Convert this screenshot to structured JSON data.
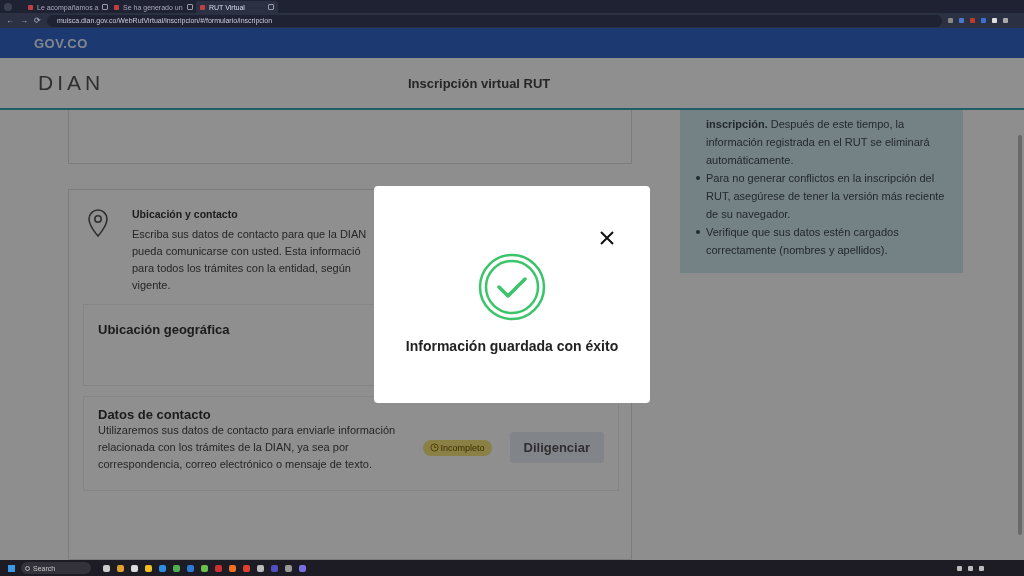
{
  "browser": {
    "nav": [
      "←",
      "→",
      "⟳"
    ],
    "tabs": [
      {
        "title": "Le acompañamos a",
        "selected": false
      },
      {
        "title": "Se ha generado un",
        "selected": false
      },
      {
        "title": "RUT Virtual",
        "selected": true
      }
    ],
    "address": "muisca.dian.gov.co/WebRutVirtual/inscripcion/#/formulario/inscripcion"
  },
  "gov_bar": {
    "logo": "GOV.CO"
  },
  "header": {
    "logo": "DIAN",
    "title": "Inscripción virtual RUT"
  },
  "location_section": {
    "title": "Ubicación y contacto",
    "lines": [
      "Escriba sus datos de contacto para que la DIAN",
      "pueda comunicarse con usted. Esta informació",
      "para todos los trámites con la entidad, según",
      "vigente."
    ],
    "geo_title": "Ubicación geográfica",
    "contact": {
      "title": "Datos de contacto",
      "description": "Utilizaremos sus datos de contacto para enviarle información relacionada con los trámites de la DIAN, ya sea por correspondencia, correo electrónico o mensaje de texto.",
      "badge": "Incompleto",
      "button": "Diligenciar"
    }
  },
  "side_panel": {
    "items": [
      {
        "text": "**inscripción.** Después de este tiempo, la información registrada en el RUT se eliminará automáticamente.",
        "bullet": false
      },
      {
        "text": "Para no generar conflictos en la inscripción del RUT, asegúrese de tener la versión más reciente de su navegador.",
        "bullet": true
      },
      {
        "text": "Verifique que sus datos estén cargados correctamente (nombres y apellidos).",
        "bullet": true
      }
    ]
  },
  "modal": {
    "message": "Información guardada con éxito"
  },
  "taskbar": {
    "search_placeholder": "Search"
  }
}
